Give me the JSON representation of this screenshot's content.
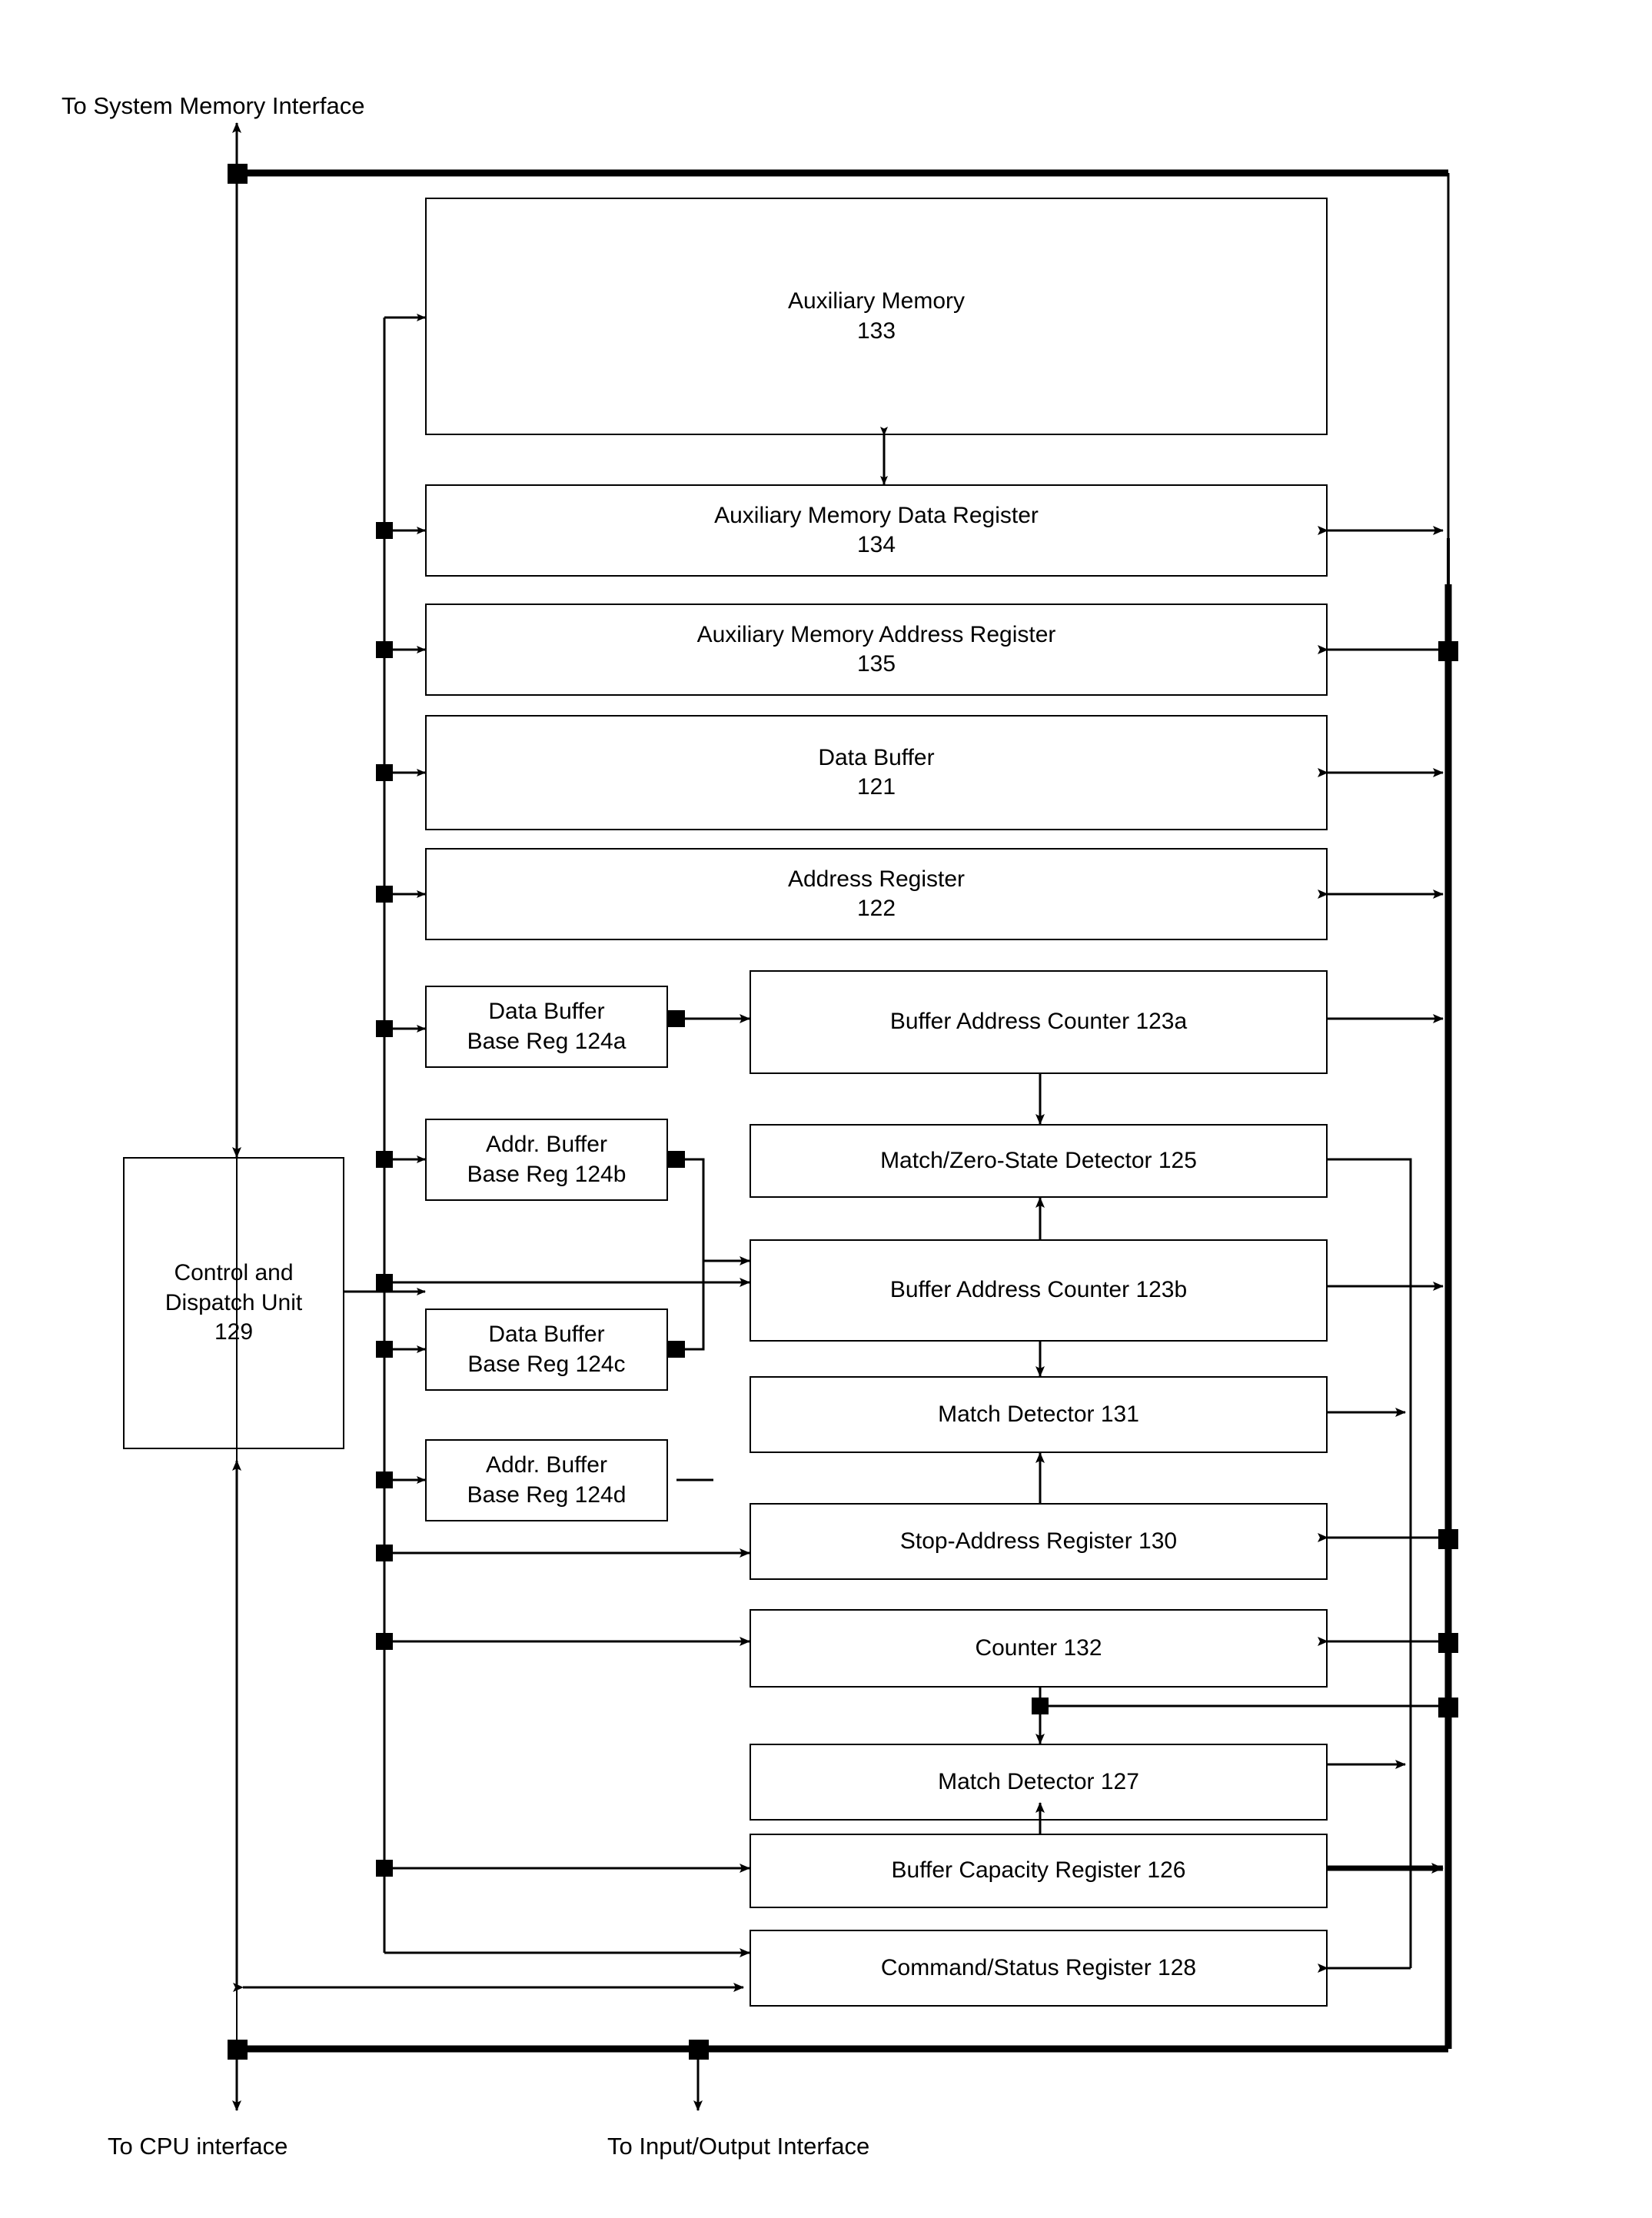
{
  "figure": {
    "title": "Buffer controller block diagram",
    "type": "block-diagram",
    "background_color": "#ffffff",
    "line_color": "#000000"
  },
  "external_labels": [
    {
      "id": "to-system-memory-interface",
      "text": "To System Memory Interface"
    },
    {
      "id": "to-cpu-interface",
      "text": "To CPU interface"
    },
    {
      "id": "to-input-output-interface-line1",
      "text": "To Input/Output"
    },
    {
      "id": "to-input-output-interface-line2",
      "text": "Interface"
    }
  ],
  "blocks": [
    {
      "id": "auxiliary-memory",
      "name_line": "Auxiliary Memory",
      "ref_line": "133"
    },
    {
      "id": "auxiliary-memory-data-register",
      "name_line": "Auxiliary Memory Data Register",
      "ref_line": "134"
    },
    {
      "id": "auxiliary-memory-address-register",
      "name_line": "Auxiliary Memory Address Register",
      "ref_line": "135"
    },
    {
      "id": "data-buffer",
      "name_line": "Data Buffer",
      "ref_line": "121"
    },
    {
      "id": "address-register",
      "name_line": "Address Register",
      "ref_line": "122"
    },
    {
      "id": "control-and-dispatch-unit",
      "name_line": "Control and",
      "name_line2": "Dispatch Unit",
      "ref_line": "129"
    },
    {
      "id": "data-buffer-base-reg-124a",
      "name_line": "Data Buffer",
      "name_line2": "Base Reg 124a"
    },
    {
      "id": "addr-buffer-base-reg-124b",
      "name_line": "Addr.  Buffer",
      "name_line2": "Base Reg 124b"
    },
    {
      "id": "data-buffer-base-reg-124c",
      "name_line": "Data Buffer",
      "name_line2": "Base Reg 124c"
    },
    {
      "id": "addr-buffer-base-reg-124d",
      "name_line": "Addr.  Buffer",
      "name_line2": "Base Reg 124d"
    },
    {
      "id": "buffer-address-counter-123a",
      "name_line": "Buffer Address Counter 123a"
    },
    {
      "id": "match-zero-state-detector-125",
      "name_line": "Match/Zero-State Detector 125"
    },
    {
      "id": "buffer-address-counter-123b",
      "name_line": "Buffer Address Counter  123b"
    },
    {
      "id": "match-detector-131",
      "name_line": "Match Detector 131"
    },
    {
      "id": "stop-address-register-130",
      "name_line": "Stop-Address Register 130"
    },
    {
      "id": "counter-132",
      "name_line": "Counter 132"
    },
    {
      "id": "match-detector-127",
      "name_line": "Match Detector 127"
    },
    {
      "id": "buffer-capacity-register-126",
      "name_line": "Buffer Capacity Register 126"
    },
    {
      "id": "command-status-register-128",
      "name_line": "Command/Status Register 128"
    }
  ]
}
